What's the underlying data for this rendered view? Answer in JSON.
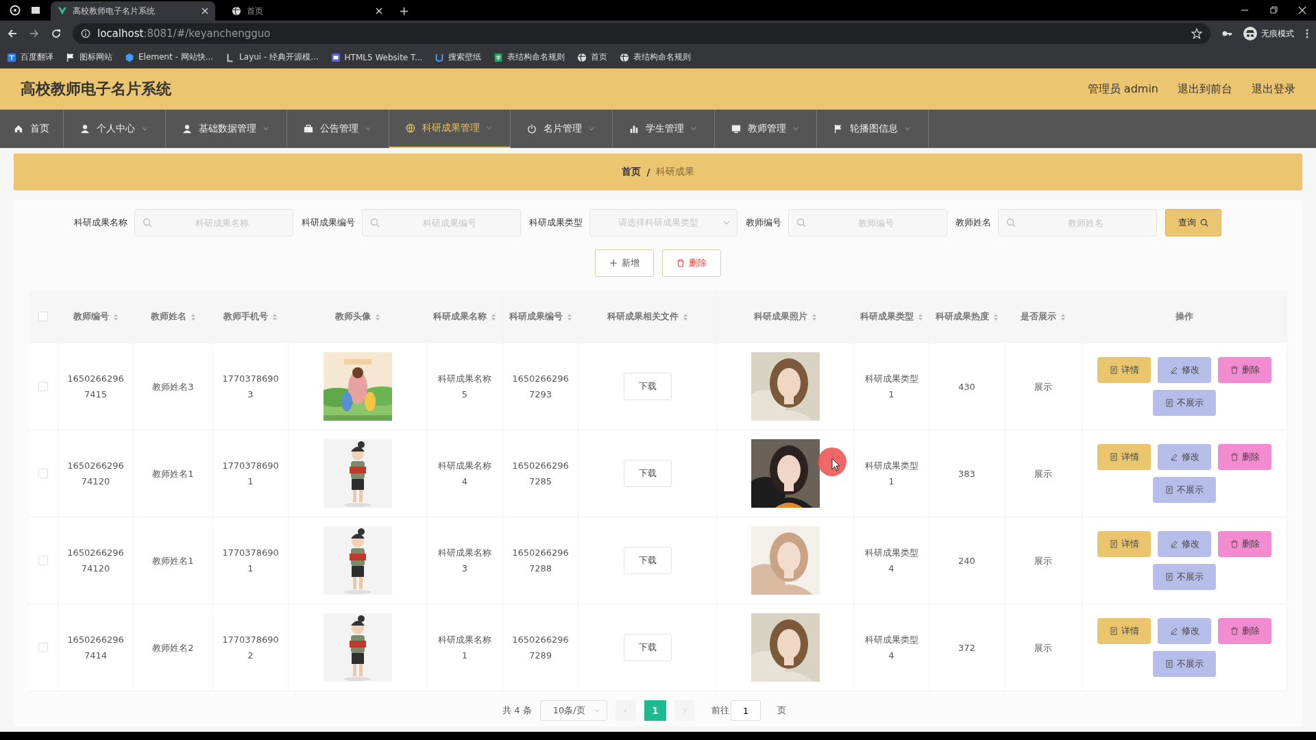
{
  "browser": {
    "tabs": [
      {
        "title": "高校教师电子名片系统",
        "selected": true
      },
      {
        "title": "首页",
        "selected": false
      }
    ],
    "new_tab": "+",
    "address": {
      "host": "localhost",
      "path": ":8081/#/keyanchengguo"
    },
    "profile": "无痕模式",
    "bookmarks": [
      "百度翻译",
      "图标网站",
      "Element - 网站快...",
      "Layui - 经典开源模...",
      "HTML5 Website T...",
      "搜索壁纸",
      "表结构命名规则",
      "首页",
      "表结构命名规则"
    ]
  },
  "header": {
    "title": "高校教师电子名片系统",
    "links": [
      "管理员 admin",
      "退出到前台",
      "退出登录"
    ]
  },
  "nav": [
    {
      "label": "首页",
      "selected": false
    },
    {
      "label": "个人中心",
      "selected": false
    },
    {
      "label": "基础数据管理",
      "selected": false
    },
    {
      "label": "公告管理",
      "selected": false
    },
    {
      "label": "科研成果管理",
      "selected": true
    },
    {
      "label": "名片管理",
      "selected": false
    },
    {
      "label": "学生管理",
      "selected": false
    },
    {
      "label": "教师管理",
      "selected": false
    },
    {
      "label": "轮播图信息",
      "selected": false
    }
  ],
  "breadcrumb": [
    "首页",
    "/",
    "科研成果"
  ],
  "search": {
    "fields": [
      {
        "label": "科研成果名称",
        "placeholder": "科研成果名称",
        "kind": "text"
      },
      {
        "label": "科研成果编号",
        "placeholder": "科研成果编号",
        "kind": "text"
      },
      {
        "label": "科研成果类型",
        "placeholder": "请选择科研成果类型",
        "kind": "select"
      },
      {
        "label": "教师编号",
        "placeholder": "教师编号",
        "kind": "text"
      },
      {
        "label": "教师姓名",
        "placeholder": "教师姓名",
        "kind": "text"
      }
    ],
    "button": "查询"
  },
  "actions": [
    {
      "label": "新增",
      "kind": "add"
    },
    {
      "label": "删除",
      "kind": "delete"
    }
  ],
  "table": {
    "select_all_checked": false,
    "columns": [
      {
        "label": "教师编号",
        "sortable": true
      },
      {
        "label": "教师姓名",
        "sortable": true
      },
      {
        "label": "教师手机号",
        "sortable": true
      },
      {
        "label": "教师头像",
        "sortable": true
      },
      {
        "label": "科研成果名称",
        "sortable": true
      },
      {
        "label": "科研成果编号",
        "sortable": true
      },
      {
        "label": "科研成果相关文件",
        "sortable": true
      },
      {
        "label": "科研成果照片",
        "sortable": true
      },
      {
        "label": "科研成果类型",
        "sortable": true
      },
      {
        "label": "科研成果热度",
        "sortable": true
      },
      {
        "label": "是否展示",
        "sortable": true
      },
      {
        "label": "操作",
        "sortable": false
      }
    ],
    "rows": [
      {
        "checked": false,
        "teacher_no": "16502662967415",
        "teacher_name": "教师姓名3",
        "phone": "17703786903",
        "result_name": "科研成果名称5",
        "result_no": "16502662967293",
        "file": "下载",
        "type": "科研成果类型1",
        "heat": "430",
        "display": "展示",
        "buttons": [
          {
            "label": "详情",
            "kind": "detail"
          },
          {
            "label": "修改",
            "kind": "edit"
          },
          {
            "label": "删除",
            "kind": "delete"
          },
          {
            "label": "不展示",
            "kind": "hide"
          }
        ]
      },
      {
        "checked": false,
        "teacher_no": "165026629674120",
        "teacher_name": "教师姓名1",
        "phone": "17703786901",
        "result_name": "科研成果名称4",
        "result_no": "16502662967285",
        "file": "下载",
        "type": "科研成果类型1",
        "heat": "383",
        "display": "展示",
        "buttons": [
          {
            "label": "详情",
            "kind": "detail"
          },
          {
            "label": "修改",
            "kind": "edit"
          },
          {
            "label": "删除",
            "kind": "delete"
          },
          {
            "label": "不展示",
            "kind": "hide"
          }
        ]
      },
      {
        "checked": false,
        "teacher_no": "165026629674120",
        "teacher_name": "教师姓名1",
        "phone": "17703786901",
        "result_name": "科研成果名称3",
        "result_no": "16502662967288",
        "file": "下载",
        "type": "科研成果类型4",
        "heat": "240",
        "display": "展示",
        "buttons": [
          {
            "label": "详情",
            "kind": "detail"
          },
          {
            "label": "修改",
            "kind": "edit"
          },
          {
            "label": "删除",
            "kind": "delete"
          },
          {
            "label": "不展示",
            "kind": "hide"
          }
        ]
      },
      {
        "checked": false,
        "teacher_no": "16502662967414",
        "teacher_name": "教师姓名2",
        "phone": "17703786902",
        "result_name": "科研成果名称1",
        "result_no": "16502662967289",
        "file": "下载",
        "type": "科研成果类型4",
        "heat": "372",
        "display": "展示",
        "buttons": [
          {
            "label": "详情",
            "kind": "detail"
          },
          {
            "label": "修改",
            "kind": "edit"
          },
          {
            "label": "删除",
            "kind": "delete"
          },
          {
            "label": "不展示",
            "kind": "hide"
          }
        ]
      }
    ]
  },
  "pagination": {
    "total": "共 4 条",
    "page_size": "10条/页",
    "pages": [
      {
        "label": "1",
        "selected": true
      }
    ],
    "goto_label": "前往",
    "goto_value": "1",
    "page_unit": "页"
  }
}
